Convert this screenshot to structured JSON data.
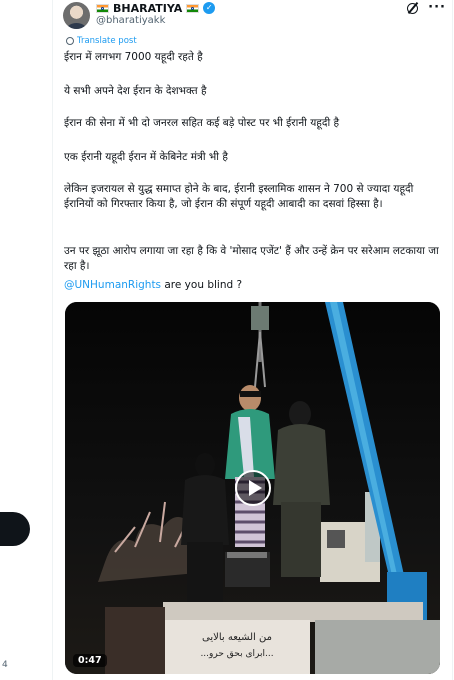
{
  "author": {
    "display_name": "BHARATIYA",
    "handle": "@bharatiyakk",
    "verified": true
  },
  "translate_label": "Translate post",
  "post_lines": [
    "ईरान में लगभग 7000 यहूदी रहते है",
    "ये सभी अपने देश ईरान के देशभक्त है",
    "ईरान की सेना में भी दो जनरल सहित कई बड़े पोस्ट पर भी  ईरानी यहूदी  है",
    "एक ईरानी यहूदी ईरान में केबिनेट मंत्री भी है",
    "लेकिन इजरायल से युद्ध समाप्त होने के बाद, ईरानी इस्लामिक शासन ने 700 से ज्यादा यहूदी ईरानियों को गिरफ्तार किया है, जो ईरान की संपूर्ण यहूदी आबादी का दसवां हिस्सा है।",
    " उन पर  झूठा आरोप लगाया जा रहा है कि वे 'मोसाद एजेंट' हैं और उन्हें क्रेन पर सरेआम लटकाया जा रहा है।"
  ],
  "mention": "@UNHumanRights",
  "mention_suffix": " are you blind ?",
  "video": {
    "duration": "0:47",
    "banner_text_line1": "من الشیعه بالایی",
    "banner_text_line2": "...ابرای بحق حرو..."
  },
  "left_panel_number": "4",
  "colors": {
    "accent": "#1d9bf0",
    "crane": "#2a8fd0",
    "text": "#0f1419",
    "muted": "#536471"
  },
  "icons": [
    "grok-icon",
    "more-icon",
    "verified-icon",
    "flag-india-icon",
    "globe-icon",
    "play-icon"
  ]
}
